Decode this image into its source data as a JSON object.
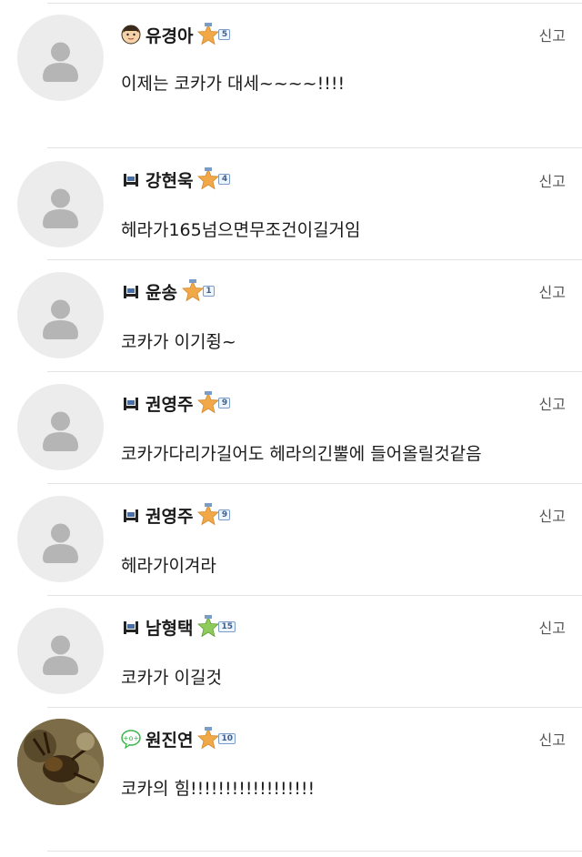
{
  "report_label": "신고",
  "comments": [
    {
      "author": "유경아",
      "level": "5",
      "text": "이제는 코카가 대세~~~~!!!!",
      "icon": "face-emoji-icon"
    },
    {
      "author": "강현욱",
      "level": "4",
      "text": "헤라가165넘으면무조건이길거임",
      "icon": "chair-icon"
    },
    {
      "author": "윤송",
      "level": "1",
      "text": "코카가 이기쥥~",
      "icon": "chair-icon"
    },
    {
      "author": "권영주",
      "level": "9",
      "text": "코카가다리가길어도 헤라의긴뿔에 들어올릴것같음",
      "icon": "chair-icon"
    },
    {
      "author": "권영주",
      "level": "9",
      "text": "헤라가이겨라",
      "icon": "chair-icon"
    },
    {
      "author": "남형택",
      "level": "15",
      "text": "코카가 이길것",
      "icon": "chair-icon"
    },
    {
      "author": "원진연",
      "level": "10",
      "text": "코카의 힘!!!!!!!!!!!!!!!!!!",
      "icon": "smile-bubble-icon"
    }
  ],
  "colors": {
    "star": "#f0a848",
    "divider": "#e3e3e3",
    "avatar_bg": "#ececec",
    "avatar_fg": "#b5b5b5"
  }
}
